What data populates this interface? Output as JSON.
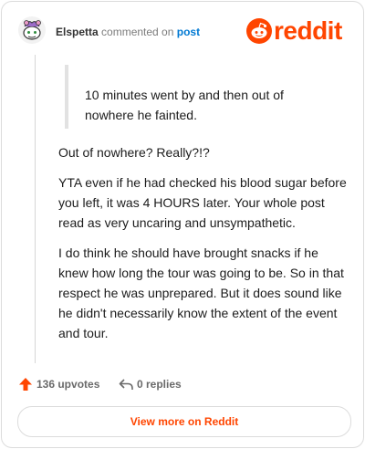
{
  "header": {
    "username": "Elspetta",
    "verb": "commented on",
    "post_link": "post",
    "logo_text": "reddit",
    "logo_icon": "reddit-snoo-icon",
    "avatar_icon": "snoo-avatar-icon"
  },
  "quote": {
    "text": "10 minutes went by and then out of nowhere he fainted."
  },
  "comment": {
    "paragraphs": [
      "Out of nowhere? Really?!?",
      "YTA even if he had checked his blood sugar before you left, it was 4 HOURS later. Your whole post read as very uncaring and unsympathetic.",
      "I do think he should have brought snacks if he knew how long the tour was going to be. So in that respect he was unprepared. But it does sound like he didn't necessarily know the extent of the event and tour."
    ]
  },
  "footer": {
    "upvotes": "136 upvotes",
    "replies": "0 replies",
    "upvote_icon": "upvote-arrow-icon",
    "reply_icon": "reply-arrow-icon"
  },
  "cta": {
    "label": "View more on Reddit"
  },
  "colors": {
    "brand": "#ff4500",
    "link": "#0079d3",
    "muted": "#7c7c7c"
  }
}
